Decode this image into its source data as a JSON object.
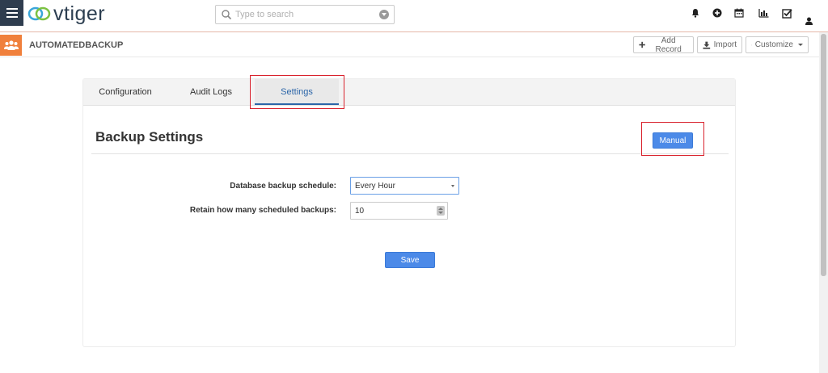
{
  "app": {
    "logo_text": "vtiger",
    "search_placeholder": "Type to search"
  },
  "module": {
    "title": "AUTOMATEDBACKUP",
    "buttons": {
      "add_record": "Add Record",
      "import": "Import",
      "customize": "Customize"
    }
  },
  "tabs": [
    {
      "label": "Configuration",
      "active": false
    },
    {
      "label": "Audit Logs",
      "active": false
    },
    {
      "label": "Settings",
      "active": true
    }
  ],
  "settings": {
    "title": "Backup Settings",
    "manual_button": "Manual",
    "schedule_label": "Database backup schedule:",
    "schedule_value": "Every Hour",
    "retain_label": "Retain how many scheduled backups:",
    "retain_value": "10",
    "save_button": "Save"
  },
  "colors": {
    "navy": "#2f3d4f",
    "accent_orange": "#f0803c",
    "primary_blue": "#4c8ae8",
    "active_tab": "#2b65a8",
    "highlight_red": "#d9232e"
  },
  "icons": [
    "menu-icon",
    "vtiger-logo-icon",
    "search-icon",
    "chevron-down-icon",
    "bell-icon",
    "plus-circle-icon",
    "calendar-icon",
    "bar-chart-icon",
    "checkbox-icon",
    "user-icon",
    "users-icon",
    "plus-icon",
    "download-icon",
    "wrench-icon",
    "caret-down-icon"
  ]
}
